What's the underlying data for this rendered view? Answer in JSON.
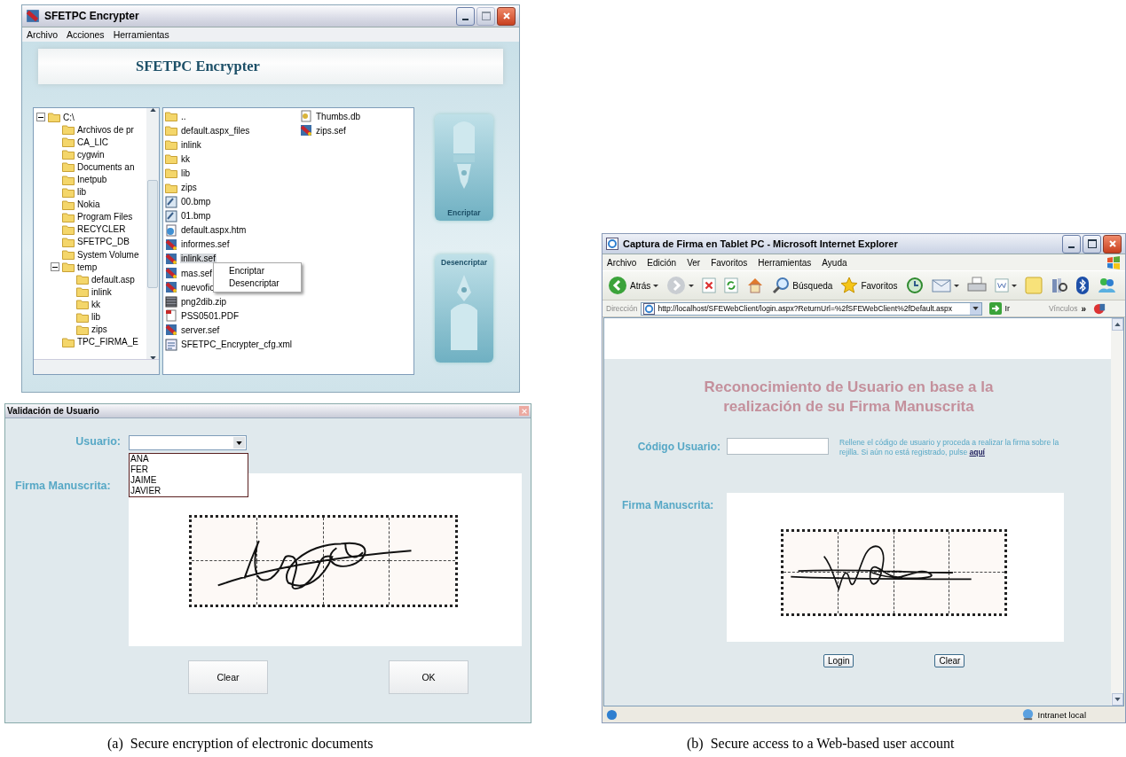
{
  "encrypter_window": {
    "title": "SFETPC Encrypter",
    "menu": [
      "Archivo",
      "Acciones",
      "Herramientas"
    ],
    "banner": "SFETPC Encrypter",
    "tree": [
      {
        "label": "C:\\",
        "expanded": true,
        "children": [
          {
            "label": "Archivos de pr"
          },
          {
            "label": "CA_LIC"
          },
          {
            "label": "cygwin"
          },
          {
            "label": "Documents an"
          },
          {
            "label": "Inetpub"
          },
          {
            "label": "lib"
          },
          {
            "label": "Nokia"
          },
          {
            "label": "Program Files"
          },
          {
            "label": "RECYCLER"
          },
          {
            "label": "SFETPC_DB"
          },
          {
            "label": "System Volume"
          },
          {
            "label": "temp",
            "expanded": true,
            "children": [
              {
                "label": "default.asp"
              },
              {
                "label": "inlink"
              },
              {
                "label": "kk"
              },
              {
                "label": "lib"
              },
              {
                "label": "zips"
              }
            ]
          },
          {
            "label": "TPC_FIRMA_E"
          }
        ]
      }
    ],
    "files": [
      {
        "name": "..",
        "kind": "folder",
        "selected": false
      },
      {
        "name": "default.aspx_files",
        "kind": "folder",
        "selected": false
      },
      {
        "name": "inlink",
        "kind": "folder",
        "selected": false
      },
      {
        "name": "kk",
        "kind": "folder",
        "selected": false
      },
      {
        "name": "lib",
        "kind": "folder",
        "selected": false
      },
      {
        "name": "zips",
        "kind": "folder",
        "selected": false
      },
      {
        "name": "00.bmp",
        "kind": "image",
        "selected": false
      },
      {
        "name": "01.bmp",
        "kind": "image",
        "selected": false
      },
      {
        "name": "default.aspx.htm",
        "kind": "web",
        "selected": false
      },
      {
        "name": "informes.sef",
        "kind": "sef",
        "selected": false
      },
      {
        "name": "inlink.sef",
        "kind": "sef",
        "selected": true
      },
      {
        "name": "mas.sef",
        "kind": "sef",
        "selected": false
      },
      {
        "name": "nuevofic",
        "kind": "sef",
        "selected": false
      },
      {
        "name": "png2dib.zip",
        "kind": "zip",
        "selected": false
      },
      {
        "name": "PSS0501.PDF",
        "kind": "pdf",
        "selected": false
      },
      {
        "name": "server.sef",
        "kind": "sef",
        "selected": false
      },
      {
        "name": "SFETPC_Encrypter_cfg.xml",
        "kind": "xml",
        "selected": false
      },
      {
        "name": "Thumbs.db",
        "kind": "db",
        "selected": false
      },
      {
        "name": "zips.sef",
        "kind": "sef",
        "selected": false
      }
    ],
    "context_menu": [
      "Encriptar",
      "Desencriptar"
    ],
    "actions": [
      {
        "label": "Encriptar",
        "kind": "encrypt"
      },
      {
        "label": "Desencriptar",
        "kind": "decrypt"
      }
    ]
  },
  "validation_dialog": {
    "title": "Validación de Usuario",
    "user_label": "Usuario:",
    "user_options": [
      "ANA",
      "FER",
      "JAIME",
      "JAVIER"
    ],
    "signature_label": "Firma Manuscrita:",
    "buttons": [
      "Clear",
      "OK"
    ]
  },
  "caption_a": "(a)  Secure encryption of electronic documents",
  "browser_window": {
    "title": "Captura de Firma en Tablet PC - Microsoft Internet Explorer",
    "menu": [
      "Archivo",
      "Edición",
      "Ver",
      "Favoritos",
      "Herramientas",
      "Ayuda"
    ],
    "toolbar": [
      {
        "kind": "back",
        "label": "Atrás",
        "dropdown": true
      },
      {
        "kind": "forward",
        "dropdown": true
      },
      {
        "kind": "stop",
        "dropdown": false
      },
      {
        "kind": "refresh",
        "dropdown": false
      },
      {
        "kind": "home",
        "dropdown": false
      },
      {
        "kind": "search",
        "label": "Búsqueda",
        "dropdown": false
      },
      {
        "kind": "favorites",
        "label": "Favoritos",
        "dropdown": false
      },
      {
        "kind": "history",
        "dropdown": false
      },
      {
        "kind": "mail",
        "dropdown": true
      },
      {
        "kind": "print",
        "dropdown": false
      },
      {
        "kind": "edit",
        "dropdown": true
      },
      {
        "kind": "notes",
        "dropdown": false
      },
      {
        "kind": "research",
        "dropdown": false
      },
      {
        "kind": "bluetooth",
        "dropdown": false
      },
      {
        "kind": "messenger",
        "dropdown": false
      }
    ],
    "address_label": "Dirección",
    "url": "http://localhost/SFEWebClient/login.aspx?ReturnUrl=%2fSFEWebClient%2fDefault.aspx",
    "go": "Ir",
    "links": "Vínculos",
    "chevron": "»",
    "page": {
      "heading": "Reconocimiento de Usuario en base a la realización de su Firma Manuscrita",
      "user_label": "Código Usuario:",
      "help": "Rellene el código de usuario y proceda a realizar la firma sobre la rejilla. Si aún no está registrado, pulse",
      "help_link": "aquí",
      "signature_label": "Firma Manuscrita:",
      "buttons": [
        "Login",
        "Clear"
      ]
    },
    "status": "Intranet local"
  },
  "caption_b": "(b)  Secure access to a Web-based user account"
}
